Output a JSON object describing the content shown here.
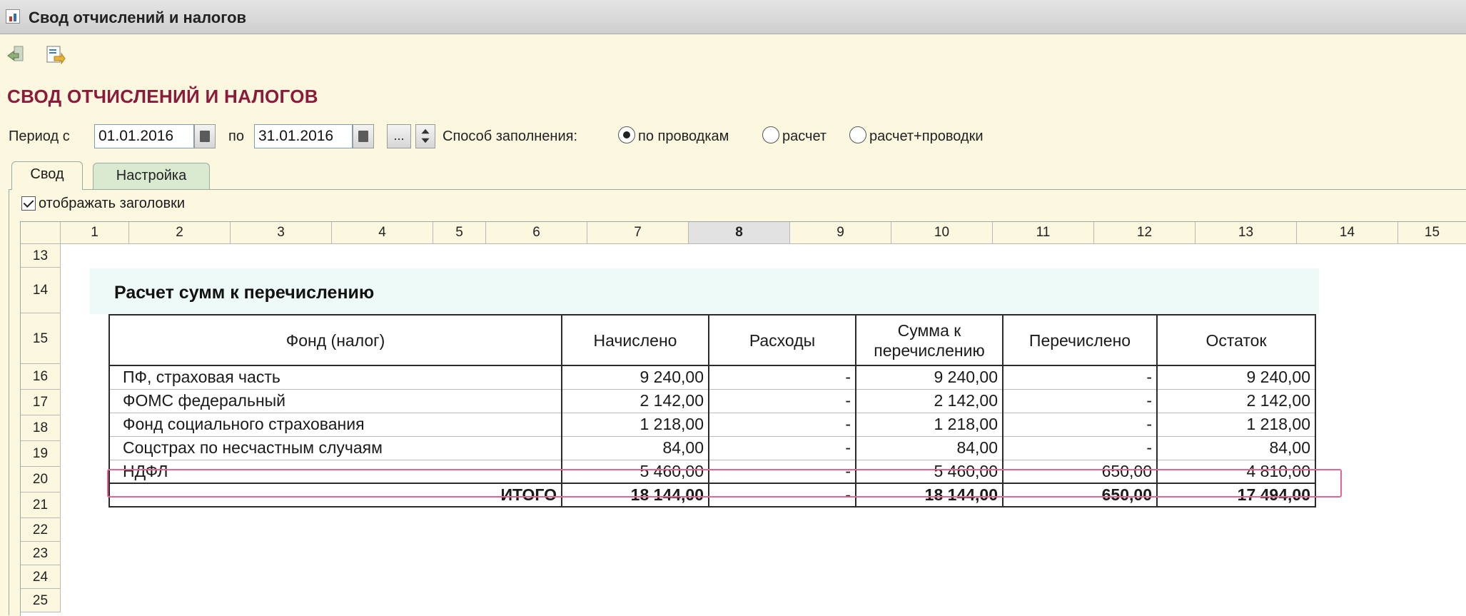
{
  "window": {
    "title": "Свод отчислений и налогов",
    "icon": "report-window-icon"
  },
  "toolbar": {
    "buttons": [
      "back-arrow-icon",
      "export-icon"
    ]
  },
  "heading": "СВОД ОТЧИСЛЕНИЙ И НАЛОГОВ",
  "period": {
    "from_label": "Период с",
    "from_value": "01.01.2016",
    "to_label": "по",
    "to_value": "31.01.2016",
    "choose_label": "...",
    "fill_label": "Способ заполнения:",
    "options": [
      "по проводкам",
      "расчет",
      "расчет+проводки"
    ],
    "selected": "по проводкам"
  },
  "tabs": [
    "Свод",
    "Настройка"
  ],
  "active_tab": "Свод",
  "show_headers": {
    "label": "отображать заголовки",
    "checked": true
  },
  "sheet": {
    "columns": [
      "1",
      "2",
      "3",
      "4",
      "5",
      "6",
      "7",
      "8",
      "9",
      "10",
      "11",
      "12",
      "13",
      "14",
      "15"
    ],
    "selected_column": "8",
    "rows": [
      "13",
      "14",
      "15",
      "16",
      "17",
      "18",
      "19",
      "20",
      "21",
      "22",
      "23",
      "24",
      "25"
    ]
  },
  "report": {
    "title": "Расчет сумм к перечислению",
    "headers": [
      "Фонд (налог)",
      "Начислено",
      "Расходы",
      "Сумма к перечислению",
      "Перечислено",
      "Остаток"
    ],
    "rows": [
      [
        "ПФ, страховая часть",
        "9 240,00",
        "-",
        "9 240,00",
        "-",
        "9 240,00"
      ],
      [
        "ФОМС федеральный",
        "2 142,00",
        "-",
        "2 142,00",
        "-",
        "2 142,00"
      ],
      [
        "Фонд социального страхования",
        "1 218,00",
        "-",
        "1 218,00",
        "-",
        "1 218,00"
      ],
      [
        "Соцстрах по несчастным случаям",
        "84,00",
        "-",
        "84,00",
        "-",
        "84,00"
      ],
      [
        "НДФЛ",
        "5 460,00",
        "-",
        "5 460,00",
        "650,00",
        "4 810,00"
      ]
    ],
    "total": [
      "ИТОГО",
      "18 144,00",
      "-",
      "18 144,00",
      "650,00",
      "17 494,00"
    ],
    "highlighted_row": "НДФЛ"
  },
  "colors": {
    "heading": "#8c1a3a",
    "highlight": "#e4668c",
    "background": "#fbf8df"
  }
}
